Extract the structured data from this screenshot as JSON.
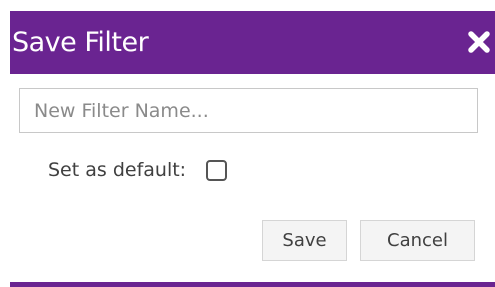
{
  "dialog": {
    "title": "Save Filter",
    "close_icon": "close-icon",
    "accent_color": "#6a2491"
  },
  "form": {
    "name_placeholder": "New Filter Name...",
    "name_value": "",
    "default_label": "Set as default:",
    "default_checked": false
  },
  "buttons": {
    "save_label": "Save",
    "cancel_label": "Cancel"
  }
}
